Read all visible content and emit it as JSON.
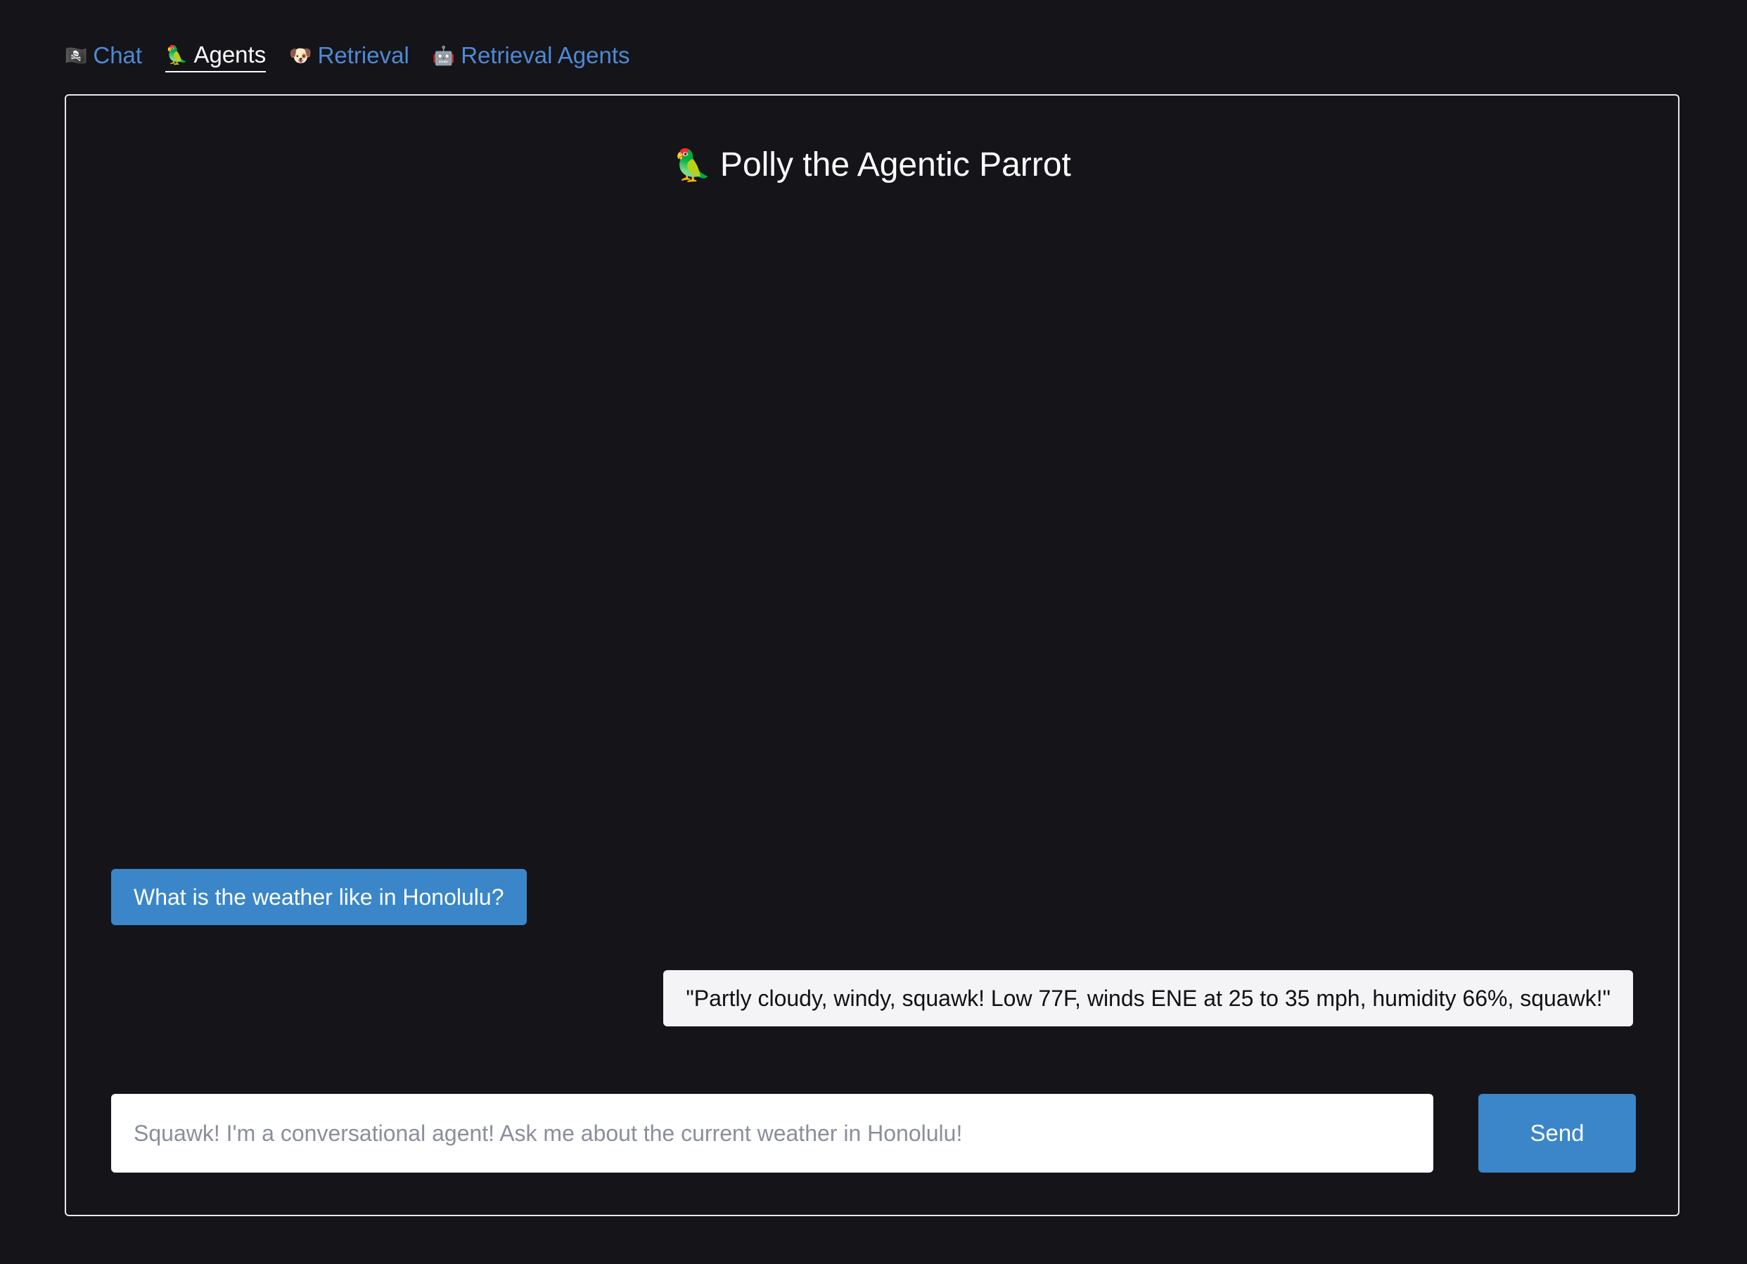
{
  "nav": {
    "items": [
      {
        "icon": "🏴‍☠️",
        "icon_name": "pirate-flag-icon",
        "label": "Chat",
        "active": false
      },
      {
        "icon": "🦜",
        "icon_name": "parrot-icon",
        "label": "Agents",
        "active": true
      },
      {
        "icon": "🐶",
        "icon_name": "dog-icon",
        "label": "Retrieval",
        "active": false
      },
      {
        "icon": "🤖",
        "icon_name": "robot-icon",
        "label": "Retrieval Agents",
        "active": false
      }
    ]
  },
  "header": {
    "icon": "🦜",
    "title": "Polly the Agentic Parrot"
  },
  "messages": [
    {
      "role": "user",
      "text": "What is the weather like in Honolulu?"
    },
    {
      "role": "assistant",
      "text": "\"Partly cloudy, windy, squawk! Low 77F, winds ENE at 25 to 35 mph, humidity 66%, squawk!\""
    }
  ],
  "composer": {
    "placeholder": "Squawk! I'm a conversational agent! Ask me about the current weather in Honolulu!",
    "value": "",
    "send_label": "Send"
  },
  "colors": {
    "background": "#141419",
    "link": "#4e8ad4",
    "accent": "#3a86c8",
    "bot_bubble": "#f4f4f6"
  }
}
